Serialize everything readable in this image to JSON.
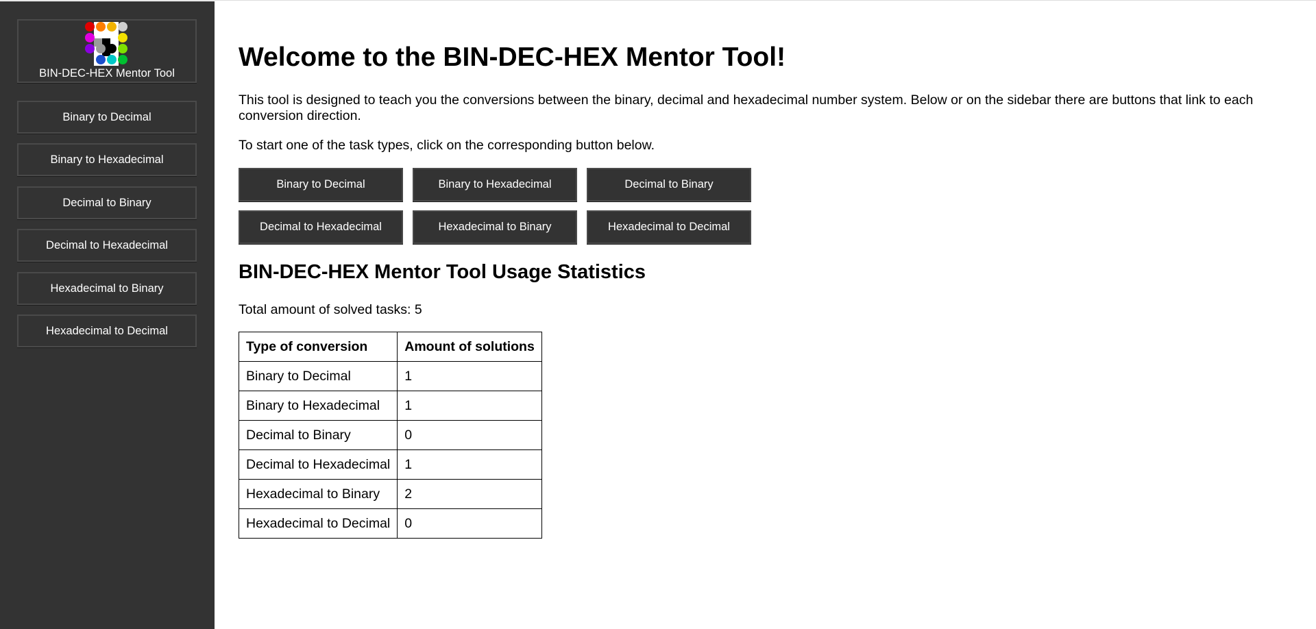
{
  "sidebar": {
    "home_label": "BIN-DEC-HEX Mentor Tool",
    "items": [
      {
        "label": "Binary to Decimal"
      },
      {
        "label": "Binary to Hexadecimal"
      },
      {
        "label": "Decimal to Binary"
      },
      {
        "label": "Decimal to Hexadecimal"
      },
      {
        "label": "Hexadecimal to Binary"
      },
      {
        "label": "Hexadecimal to Decimal"
      }
    ]
  },
  "logo": {
    "icon": "colored-dot-grid-logo",
    "colors": [
      "#e00000",
      "#ff7f00",
      "#f2b300",
      "#cfcfcf",
      "#e000e0",
      "#ffffff",
      "#ffffff",
      "#f2e000",
      "#8a00e0",
      "#9a9a9a",
      "#000000",
      "#7fe000",
      "#1a4fcc",
      "#00c8c8",
      "#00c030"
    ]
  },
  "main": {
    "title": "Welcome to the BIN-DEC-HEX Mentor Tool!",
    "intro": "This tool is designed to teach you the conversions between the binary, decimal and hexadecimal number system. Below or on the sidebar there are buttons that link to each conversion direction.",
    "start_text": "To start one of the task types, click on the corresponding button below.",
    "buttons": [
      {
        "label": "Binary to Decimal"
      },
      {
        "label": "Binary to Hexadecimal"
      },
      {
        "label": "Decimal to Binary"
      },
      {
        "label": "Decimal to Hexadecimal"
      },
      {
        "label": "Hexadecimal to Binary"
      },
      {
        "label": "Hexadecimal to Decimal"
      }
    ],
    "stats_title": "BIN-DEC-HEX Mentor Tool Usage Statistics",
    "total_text": "Total amount of solved tasks: 5",
    "table": {
      "headers": [
        "Type of conversion",
        "Amount of solutions"
      ],
      "rows": [
        [
          "Binary to Decimal",
          "1"
        ],
        [
          "Binary to Hexadecimal",
          "1"
        ],
        [
          "Decimal to Binary",
          "0"
        ],
        [
          "Decimal to Hexadecimal",
          "1"
        ],
        [
          "Hexadecimal to Binary",
          "2"
        ],
        [
          "Hexadecimal to Decimal",
          "0"
        ]
      ]
    }
  },
  "colors": {
    "sidebar_bg": "#333333",
    "button_bg": "#333333",
    "button_text": "#ffffff"
  }
}
